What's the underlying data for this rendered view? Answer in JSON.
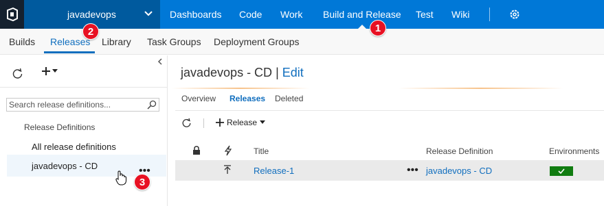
{
  "topnav": {
    "project": "javadevops",
    "hubs": [
      "Dashboards",
      "Code",
      "Work",
      "Build and Release",
      "Test",
      "Wiki"
    ],
    "active_hub": "Build and Release",
    "bg_color": "#0078d7"
  },
  "subnav": {
    "tabs": [
      "Builds",
      "Releases",
      "Library",
      "Task Groups",
      "Deployment Groups"
    ],
    "active_tab": "Releases"
  },
  "badges": [
    "1",
    "2",
    "3"
  ],
  "left": {
    "search_placeholder": "Search release definitions...",
    "heading": "Release Definitions",
    "items": [
      "All release definitions",
      "javadevops - CD"
    ],
    "selected_more": "•••"
  },
  "main": {
    "title": "javadevops - CD",
    "title_sep": "|",
    "edit_label": "Edit",
    "tabs": [
      "Overview",
      "Releases",
      "Deleted"
    ],
    "active_tab": "Releases",
    "release_button": "Release",
    "columns": [
      "Title",
      "Release Definition",
      "Environments"
    ],
    "rows": [
      {
        "title": "Release-1",
        "more": "•••",
        "definition": "javadevops - CD",
        "env_status": "succeeded"
      }
    ],
    "env_color": "#107c10"
  }
}
